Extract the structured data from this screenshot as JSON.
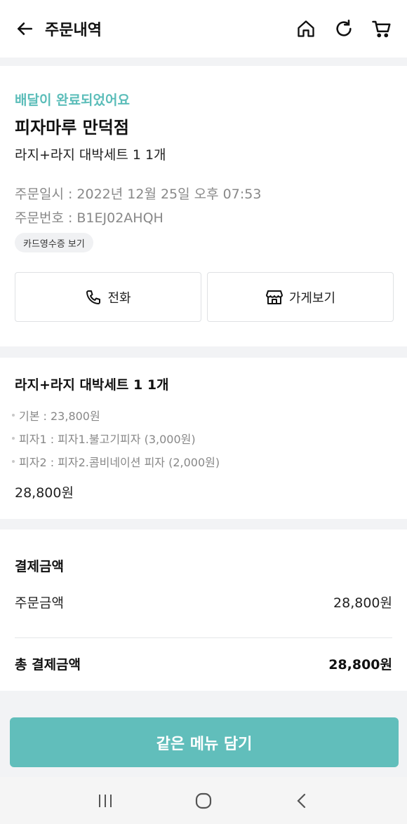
{
  "header": {
    "title": "주문내역",
    "icons": [
      "back-arrow-icon",
      "home-icon",
      "refresh-icon",
      "cart-icon"
    ]
  },
  "order": {
    "status": "배달이 완료되었어요",
    "store": "피자마루 만덕점",
    "summary": "라지+라지 대박세트 1 1개",
    "order_date": "주문일시 : 2022년 12월 25일 오후 07:53",
    "order_no": "주문번호 : B1EJ02AHQH",
    "receipt_label": "카드영수증 보기",
    "call_label": "전화",
    "store_label": "가게보기"
  },
  "menu": {
    "title": "라지+라지 대박세트 1 1개",
    "options": [
      "기본 : 23,800원",
      "피자1 : 피자1.불고기피자 (3,000원)",
      "피자2 : 피자2.콤비네이션 피자 (2,000원)"
    ],
    "price": "28,800원"
  },
  "payment": {
    "title": "결제금액",
    "order_amount_label": "주문금액",
    "order_amount_value": "28,800원",
    "total_label": "총 결제금액",
    "total_value": "28,800원"
  },
  "cta": {
    "label": "같은 메뉴 담기"
  },
  "colors": {
    "accent": "#5bbdb9",
    "cta": "#61bebb"
  }
}
